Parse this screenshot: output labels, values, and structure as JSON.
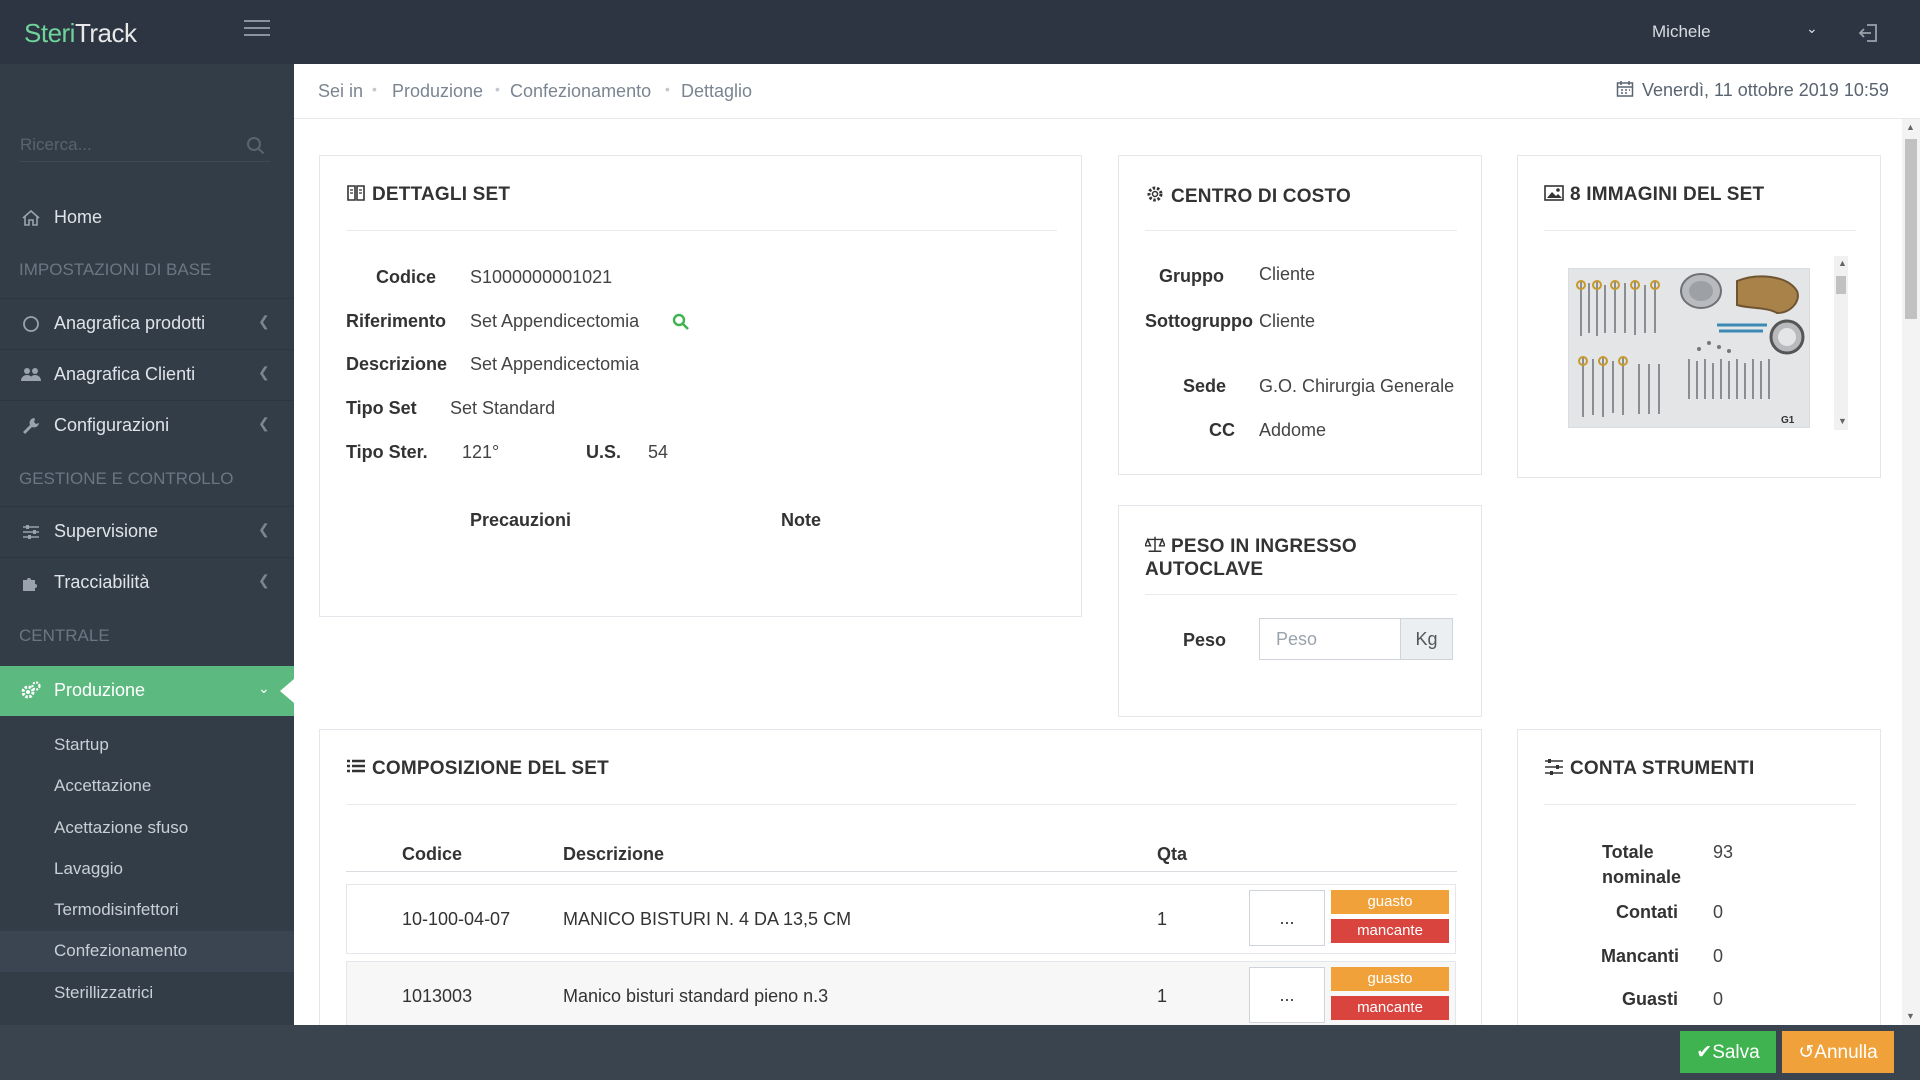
{
  "app": {
    "logo_a": "Steri",
    "logo_b": "Track",
    "user": "Michele"
  },
  "search": {
    "placeholder": "Ricerca..."
  },
  "sidebar": {
    "home": "Home",
    "section_base": "IMPOSTAZIONI DI BASE",
    "anagrafica_prodotti": "Anagrafica prodotti",
    "anagrafica_clienti": "Anagrafica Clienti",
    "configurazioni": "Configurazioni",
    "section_gestione": "GESTIONE E CONTROLLO",
    "supervisione": "Supervisione",
    "tracciabilita": "Tracciabilità",
    "section_centrale": "CENTRALE",
    "produzione": "Produzione",
    "sub": [
      "Startup",
      "Accettazione",
      "Acettazione sfuso",
      "Lavaggio",
      "Termodisinfettori",
      "Confezionamento",
      "Sterillizzatrici"
    ]
  },
  "breadcrumb": {
    "root": "Sei in",
    "items": [
      "Produzione",
      "Confezionamento",
      "Dettaglio"
    ]
  },
  "date": "Venerdì, 11 ottobre 2019 10:59",
  "dettagli": {
    "title": "DETTAGLI SET",
    "codice_label": "Codice",
    "codice": "S1000000001021",
    "riferimento_label": "Riferimento",
    "riferimento": "Set Appendicectomia",
    "descrizione_label": "Descrizione",
    "descrizione": "Set Appendicectomia",
    "tipo_set_label": "Tipo Set",
    "tipo_set": "Set Standard",
    "tipo_ster_label": "Tipo Ster.",
    "tipo_ster": "121°",
    "us_label": "U.S.",
    "us": "54",
    "precauzioni_label": "Precauzioni",
    "note_label": "Note"
  },
  "centro": {
    "title": "CENTRO DI COSTO",
    "gruppo_label": "Gruppo",
    "gruppo": "Cliente",
    "sottogruppo_label": "Sottogruppo",
    "sottogruppo": "Cliente",
    "sede_label": "Sede",
    "sede": "G.O. Chirurgia Generale",
    "cc_label": "CC",
    "cc": "Addome"
  },
  "immagini": {
    "title": "8 IMMAGINI DEL SET",
    "caption": "G1"
  },
  "peso": {
    "title_line1": "PESO IN INGRESSO",
    "title_line2": "AUTOCLAVE",
    "label": "Peso",
    "placeholder": "Peso",
    "unit": "Kg"
  },
  "composizione": {
    "title": "COMPOSIZIONE DEL SET",
    "headers": {
      "codice": "Codice",
      "descrizione": "Descrizione",
      "qta": "Qta"
    },
    "rows": [
      {
        "codice": "10-100-04-07",
        "descrizione": "MANICO BISTURI N. 4 DA 13,5 CM",
        "qta": "1",
        "btn": "...",
        "guasto": "guasto",
        "mancante": "mancante"
      },
      {
        "codice": "1013003",
        "descrizione": "Manico bisturi standard pieno n.3",
        "qta": "1",
        "btn": "...",
        "guasto": "guasto",
        "mancante": "mancante"
      }
    ]
  },
  "conta": {
    "title": "CONTA STRUMENTI",
    "totale_label_1": "Totale",
    "totale_label_2": "nominale",
    "totale": "93",
    "contati_label": "Contati",
    "contati": "0",
    "mancanti_label": "Mancanti",
    "mancanti": "0",
    "guasti_label": "Guasti",
    "guasti": "0"
  },
  "footer": {
    "save": "Salva",
    "cancel": "Annulla"
  },
  "colors": {
    "header": "#2c3541",
    "sidebar": "#333d48",
    "active": "#5cb97f",
    "save": "#3fb34f",
    "cancel": "#f0a13a",
    "mancante": "#d9443f"
  }
}
